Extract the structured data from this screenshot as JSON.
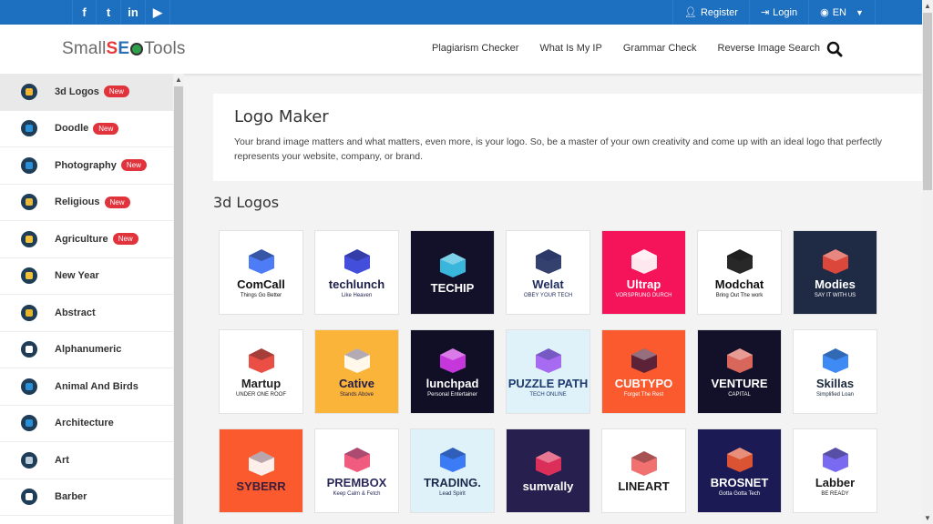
{
  "topbar": {
    "social": [
      {
        "icon": "facebook-icon",
        "glyph": "f"
      },
      {
        "icon": "twitter-icon",
        "glyph": "t"
      },
      {
        "icon": "linkedin-icon",
        "glyph": "in"
      },
      {
        "icon": "youtube-icon",
        "glyph": "▶"
      }
    ],
    "register_label": "Register",
    "login_label": "Login",
    "language_label": "EN"
  },
  "header": {
    "logo": {
      "part1": "Small",
      "part2": "S",
      "part3": "E",
      "part4": "Tools"
    },
    "nav": [
      "Plagiarism Checker",
      "What Is My IP",
      "Grammar Check",
      "Reverse Image Search"
    ]
  },
  "sidebar": {
    "items": [
      {
        "label": "3d Logos",
        "badge": "New",
        "active": true,
        "icon_color": "#f2b632"
      },
      {
        "label": "Doodle",
        "badge": "New",
        "active": false,
        "icon_color": "#2a8fd6"
      },
      {
        "label": "Photography",
        "badge": "New",
        "active": false,
        "icon_color": "#2a8fd6"
      },
      {
        "label": "Religious",
        "badge": "New",
        "active": false,
        "icon_color": "#e8b93c"
      },
      {
        "label": "Agriculture",
        "badge": "New",
        "active": false,
        "icon_color": "#f0c23a"
      },
      {
        "label": "New Year",
        "badge": "",
        "active": false,
        "icon_color": "#f0c23a"
      },
      {
        "label": "Abstract",
        "badge": "",
        "active": false,
        "icon_color": "#e7b52a"
      },
      {
        "label": "Alphanumeric",
        "badge": "",
        "active": false,
        "icon_color": "#fff"
      },
      {
        "label": "Animal And Birds",
        "badge": "",
        "active": false,
        "icon_color": "#2a8fd6"
      },
      {
        "label": "Architecture",
        "badge": "",
        "active": false,
        "icon_color": "#2a8fd6"
      },
      {
        "label": "Art",
        "badge": "",
        "active": false,
        "icon_color": "#bcd"
      },
      {
        "label": "Barber",
        "badge": "",
        "active": false,
        "icon_color": "#fff"
      }
    ]
  },
  "intro": {
    "title": "Logo Maker",
    "description": "Your brand image matters and what matters, even more, is your logo. So, be a master of your own creativity and come up with an ideal logo that perfectly represents your website, company, or brand."
  },
  "section": {
    "title": "3d Logos"
  },
  "logos": [
    {
      "name": "ComCall",
      "tagline": "Things Go Better",
      "bg": "#ffffff",
      "fg": "#111111",
      "accent": "#3b6ef5"
    },
    {
      "name": "techlunch",
      "tagline": "Like Heaven",
      "bg": "#ffffff",
      "fg": "#1d1f4a",
      "accent": "#2f3bd6"
    },
    {
      "name": "TECHIP",
      "tagline": "",
      "bg": "#13112a",
      "fg": "#ffffff",
      "accent": "#3ec9f0"
    },
    {
      "name": "Welat",
      "tagline": "OBEY YOUR TECH",
      "bg": "#ffffff",
      "fg": "#1e2b5e",
      "accent": "#1e2b5e"
    },
    {
      "name": "Ultrap",
      "tagline": "VORSPRUNG DURCH",
      "bg": "#f5145a",
      "fg": "#ffffff",
      "accent": "#ffffff"
    },
    {
      "name": "Modchat",
      "tagline": "Bring Out The work",
      "bg": "#ffffff",
      "fg": "#111111",
      "accent": "#111111"
    },
    {
      "name": "Modies",
      "tagline": "SAY IT WITH US",
      "bg": "#1f2b45",
      "fg": "#ffffff",
      "accent": "#ef4b3a"
    },
    {
      "name": "Martup",
      "tagline": "UNDER ONE ROOF",
      "bg": "#ffffff",
      "fg": "#222222",
      "accent": "#e93b30"
    },
    {
      "name": "Cative",
      "tagline": "Stands Above",
      "bg": "#fbb43a",
      "fg": "#231d4a",
      "accent": "#ffffff"
    },
    {
      "name": "lunchpad",
      "tagline": "Personal Entertainer",
      "bg": "#100f26",
      "fg": "#ffffff",
      "accent": "#d93cf0"
    },
    {
      "name": "PUZZLE PATH",
      "tagline": "TECH ONLINE",
      "bg": "#dff2fa",
      "fg": "#1e3a6e",
      "accent": "#a05cf0"
    },
    {
      "name": "CUBTYPO",
      "tagline": "Forget The Rest",
      "bg": "#fa5a2d",
      "fg": "#ffffff",
      "accent": "#4a1d3a"
    },
    {
      "name": "VENTURE",
      "tagline": "CAPITAL",
      "bg": "#13112a",
      "fg": "#ffffff",
      "accent": "#f07060"
    },
    {
      "name": "Skillas",
      "tagline": "Simplified Loan",
      "bg": "#ffffff",
      "fg": "#1a2a3c",
      "accent": "#2a7ef5"
    },
    {
      "name": "SYBERR",
      "tagline": "",
      "bg": "#fa5a2d",
      "fg": "#3a1d3a",
      "accent": "#ffffff"
    },
    {
      "name": "PREMBOX",
      "tagline": "Keep Calm & Fetch",
      "bg": "#ffffff",
      "fg": "#2a2a5a",
      "accent": "#f04a70"
    },
    {
      "name": "TRADING.",
      "tagline": "Lead Spirit",
      "bg": "#dff2fa",
      "fg": "#1a2a4a",
      "accent": "#2a6ef5"
    },
    {
      "name": "sumvally",
      "tagline": "",
      "bg": "#27204f",
      "fg": "#ffffff",
      "accent": "#f0305a"
    },
    {
      "name": "LINEART",
      "tagline": "",
      "bg": "#ffffff",
      "fg": "#1a1a1a",
      "accent": "#f06060"
    },
    {
      "name": "BROSNET",
      "tagline": "Gotta Gotta Tech",
      "bg": "#1b1a55",
      "fg": "#ffffff",
      "accent": "#f05a30"
    },
    {
      "name": "Labber",
      "tagline": "BE READY",
      "bg": "#ffffff",
      "fg": "#1a1a1a",
      "accent": "#6a5af0"
    }
  ]
}
